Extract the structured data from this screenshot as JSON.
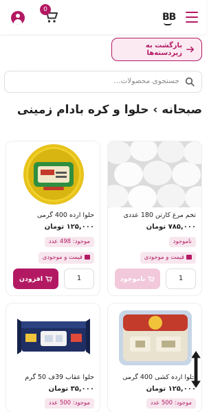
{
  "header": {
    "logo": "BB",
    "cart_count": "0"
  },
  "nav": {
    "back_label": "بازگشت به زیردسته‌ها"
  },
  "search": {
    "placeholder": "جستجوی محصولات..."
  },
  "page": {
    "title": "صبحانه › حلوا و کره بادام زمینی"
  },
  "products": [
    {
      "name": "تخم مرغ کارتن 180 عددی",
      "price": "۷۸۵,۰۰۰ تومان",
      "stock": "ناموجود",
      "price_info": "قیمت و موجودی",
      "qty": "1",
      "action": "ناموجود",
      "available": false
    },
    {
      "name": "حلوا ارده 400 گرمی",
      "price": "۱۲۵,۰۰۰ تومان",
      "stock": "موجود: 498 عدد",
      "price_info": "قیمت و موجودی",
      "qty": "1",
      "action": "افزودن",
      "available": true
    },
    {
      "name": "حلوا ارده کشی 400 گرمی",
      "price": "۱۲۵,۰۰۰ تومان",
      "stock": "موجود: 500 عدد",
      "available": true
    },
    {
      "name": "حلوا عقاب 39ف 50 گرم",
      "price": "۳۵,۰۰۰ تومان",
      "stock": "موجود: 500 عدد",
      "available": true
    }
  ],
  "colors": {
    "accent": "#b31963",
    "accent_light": "#f7e6ee"
  }
}
